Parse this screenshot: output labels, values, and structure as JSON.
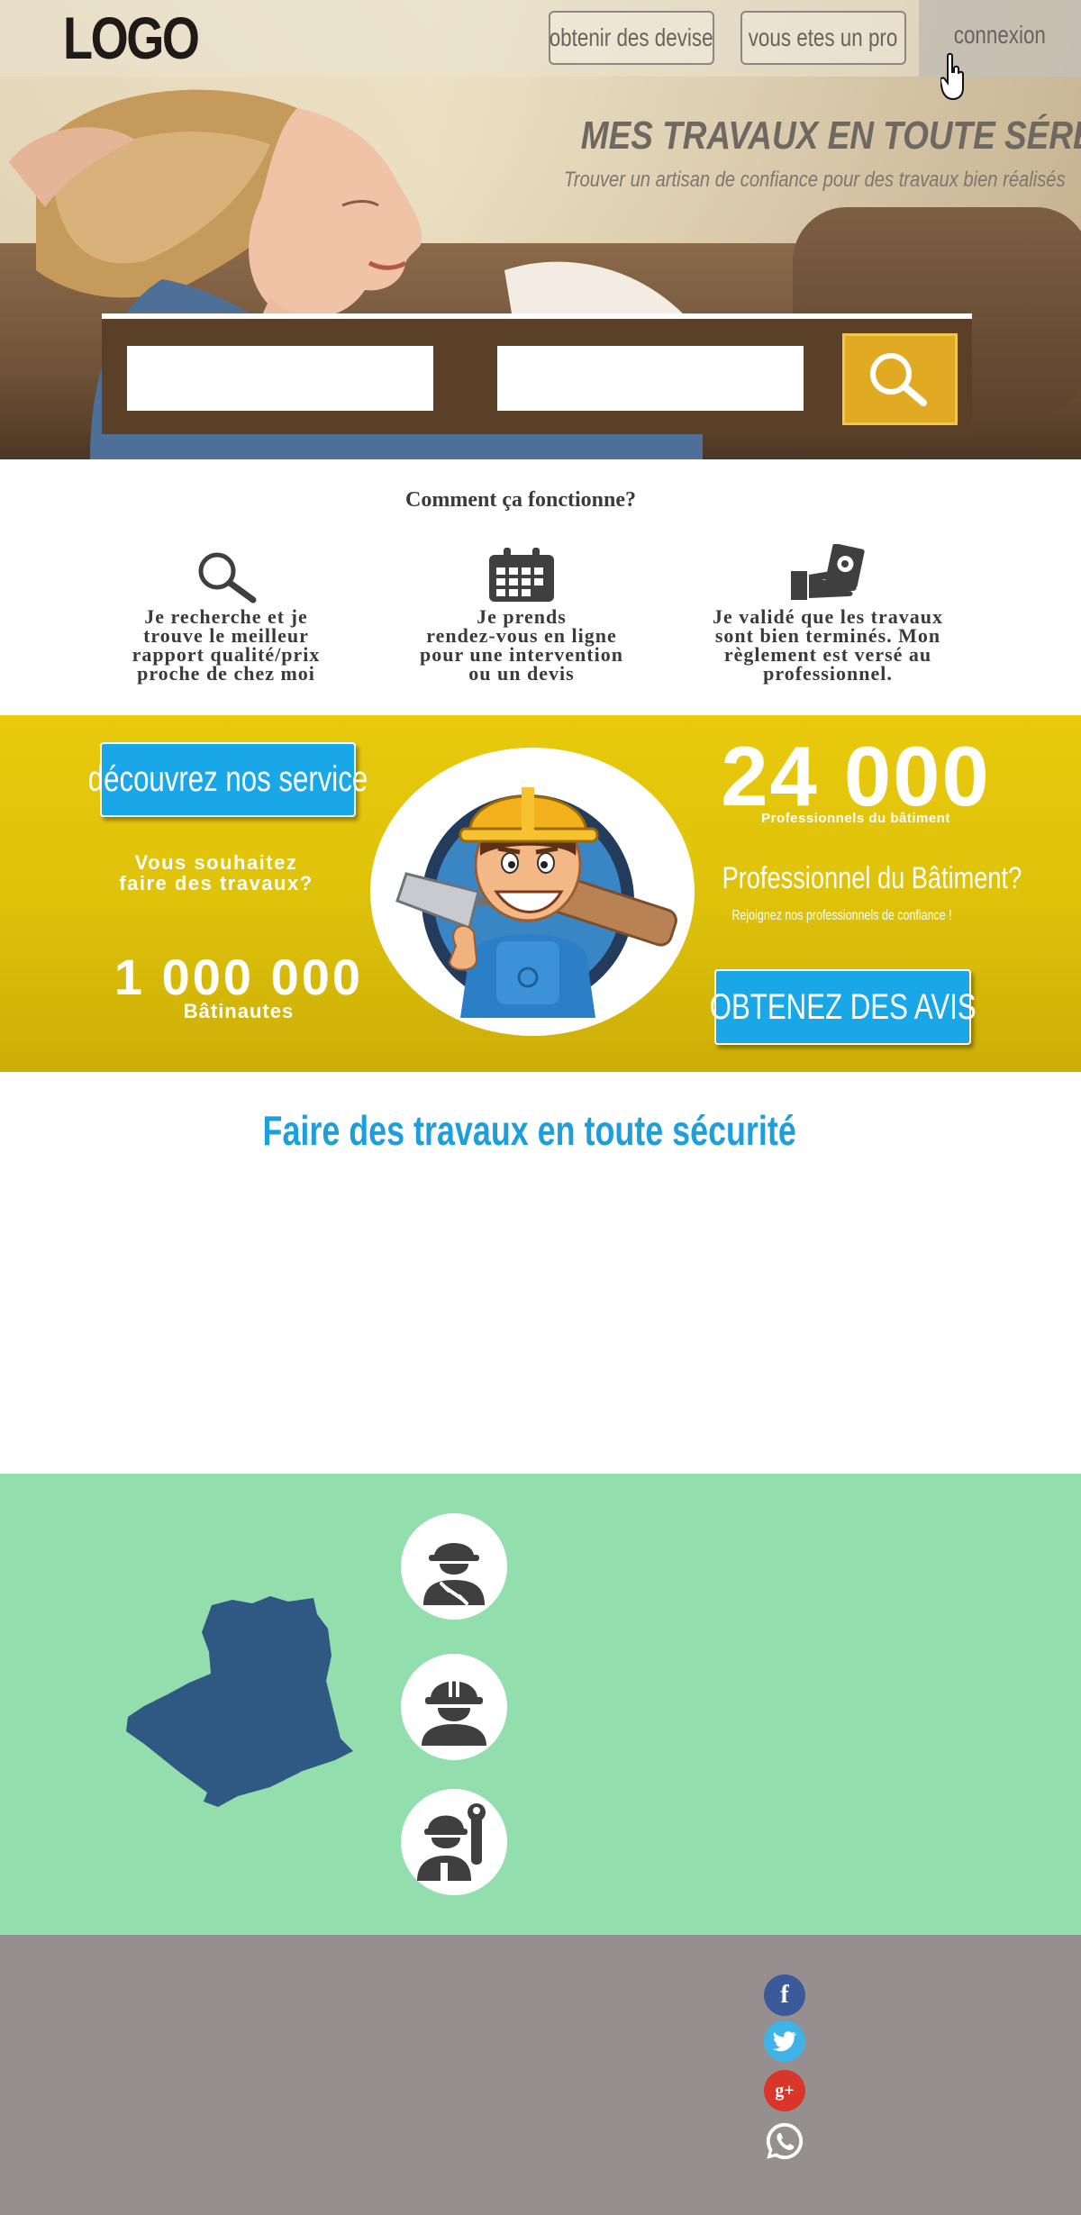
{
  "header": {
    "logo": "LOGO",
    "nav": {
      "quote_label": "obtenir des devise",
      "pro_label": "vous etes un pro",
      "login_label": "connexion"
    }
  },
  "hero": {
    "title": "MES TRAVAUX EN TOUTE SÉRÉNITÉ",
    "subtitle": "Trouver un artisan de confiance pour des travaux bien réalisés",
    "search": {
      "field1_value": "",
      "field2_value": "",
      "button_icon": "search-icon"
    }
  },
  "how": {
    "title": "Comment ça fonctionne?",
    "steps": [
      {
        "icon": "search-icon",
        "lines": [
          "Je recherche et je",
          "trouve le meilleur",
          "rapport qualité/prix",
          "proche de chez moi"
        ]
      },
      {
        "icon": "calendar-icon",
        "lines": [
          "Je prends",
          "rendez-vous en ligne",
          "pour une intervention",
          "ou un devis"
        ]
      },
      {
        "icon": "payment-hand-icon",
        "lines": [
          "Je validé que les travaux",
          "sont bien terminés. Mon",
          "règlement est versé au",
          "professionnel."
        ]
      }
    ]
  },
  "band": {
    "discover_label": "découvrez nos service",
    "question_lines": [
      "Vous souhaitez",
      "faire des travaux?"
    ],
    "users_count": "1 000 000",
    "users_label": "Bâtinautes",
    "pros_count": "24 000",
    "pros_label": "Professionnels du bâtiment",
    "pro_question": "Professionnel du Bâtiment?",
    "pro_invite": "Rejoignez nos professionnels de confiance !",
    "reviews_label": "OBTENEZ DES AVIS",
    "mascot": "builder-mascot-illustration"
  },
  "security": {
    "title": "Faire des travaux en toute sécurité"
  },
  "coverage": {
    "map": "algeria-map",
    "workers": [
      "worker-wrench-icon",
      "worker-helmet-icon",
      "worker-tools-icon"
    ]
  },
  "footer": {
    "social": [
      "facebook-icon",
      "twitter-icon",
      "google-plus-icon",
      "whatsapp-icon"
    ],
    "fb_glyph": "f",
    "gp_glyph": "g+"
  },
  "colors": {
    "accent_blue": "#1aa7e8",
    "band_yellow": "#e0c20b",
    "search_gold": "#e0ab23",
    "green_section": "#92dead",
    "footer_gray": "#958f8f",
    "map_blue": "#2f5983"
  }
}
